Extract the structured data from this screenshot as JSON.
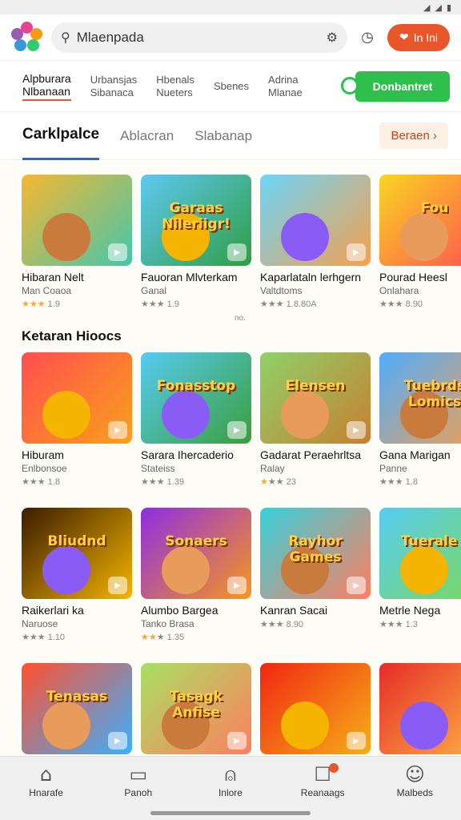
{
  "search": {
    "value": "Mlaenpada"
  },
  "header": {
    "red_button_label": "In Ini"
  },
  "categories": [
    {
      "title": "Alpburara",
      "sub": "Nlbanaan"
    },
    {
      "title": "Urbansjas",
      "sub": "Sibanaca"
    },
    {
      "title": "Hbenals",
      "sub": "Nueters"
    },
    {
      "title": "Sbenes",
      "sub": ""
    },
    {
      "title": "Adrina",
      "sub": "Mlanae"
    }
  ],
  "download_label": "Donbantret",
  "tabs": [
    "Carklpalce",
    "Ablacran",
    "Slabanap"
  ],
  "see_more": "Beraen",
  "rows": [
    [
      {
        "title": "Hibaran Nelt",
        "sub": "Man Coaoa",
        "rating": "1.9",
        "stars": 3,
        "big": ""
      },
      {
        "title": "Fauoran Mlvterkam",
        "sub": "Ganal",
        "rating": "1.9",
        "stars": 0,
        "big": "Garaas Nileriigr!"
      },
      {
        "title": "Kaparlataln lerhgern",
        "sub": "Valtdtoms",
        "rating": "1.8.80A",
        "stars": 0,
        "big": ""
      },
      {
        "title": "Pourad Heesl",
        "sub": "Onlahara",
        "rating": "8.90",
        "stars": 0,
        "big": "Fou"
      }
    ],
    [
      {
        "title": "Hiburam",
        "sub": "Enlbonsoe",
        "rating": "1.8",
        "stars": 0,
        "big": ""
      },
      {
        "title": "Sarara Ihercaderio",
        "sub": "Stateiss",
        "rating": "1.39",
        "stars": 0,
        "big": "Fonasstop"
      },
      {
        "title": "Gadarat Peraehrltsa",
        "sub": "Ralay",
        "rating": "23",
        "stars": 1,
        "big": "Elensen"
      },
      {
        "title": "Gana Marigan",
        "sub": "Panne",
        "rating": "1.8",
        "stars": 0,
        "big": "Tuebrds Lomics"
      }
    ],
    [
      {
        "title": "Raikerlari ka",
        "sub": "Naruose",
        "rating": "1.10",
        "stars": 0,
        "big": "Bliudnd"
      },
      {
        "title": "Alumbo Bargea",
        "sub": "Tanko Brasa",
        "rating": "1.35",
        "stars": 2,
        "big": "Sonaers"
      },
      {
        "title": "Kanran Sacai",
        "sub": "",
        "rating": "8.90",
        "stars": 0,
        "big": "Rayhor Games"
      },
      {
        "title": "Metrle Nega",
        "sub": "",
        "rating": "1.3",
        "stars": 0,
        "big": "Tuerale !"
      }
    ],
    [
      {
        "title": "",
        "sub": "",
        "rating": "",
        "stars": 0,
        "big": "Tenasas"
      },
      {
        "title": "",
        "sub": "",
        "rating": "",
        "stars": 0,
        "big": "Tasagk Anfise"
      },
      {
        "title": "",
        "sub": "",
        "rating": "",
        "stars": 0,
        "big": ""
      },
      {
        "title": "",
        "sub": "",
        "rating": "",
        "stars": 0,
        "big": ""
      }
    ]
  ],
  "note": "no.",
  "section_title": "Ketaran Hioocs",
  "bottom_nav": [
    {
      "label": "Hnarafe",
      "icon": "home-icon"
    },
    {
      "label": "Panoh",
      "icon": "document-icon"
    },
    {
      "label": "Inlore",
      "icon": "bell-icon"
    },
    {
      "label": "Reanaags",
      "icon": "inbox-icon"
    },
    {
      "label": "Malbeds",
      "icon": "profile-icon"
    }
  ],
  "colors": {
    "accent": "#e8562a",
    "download": "#2fbf4d",
    "tab_underline": "#1a6fd0"
  }
}
